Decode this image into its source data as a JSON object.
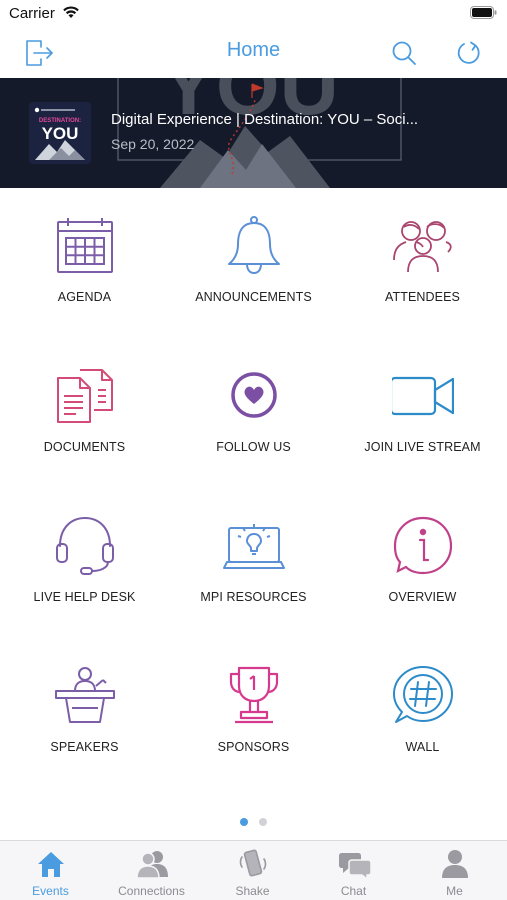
{
  "status": {
    "carrier": "Carrier"
  },
  "nav": {
    "title": "Home",
    "left_icon": "logout-icon",
    "search_icon": "search-icon",
    "refresh_icon": "refresh-icon"
  },
  "banner": {
    "title": "Digital Experience | Destination: YOU – Soci...",
    "date": "Sep 20, 2022",
    "thumb_text": "YOU",
    "thumb_subtext": "DESTINATION:"
  },
  "tiles": [
    {
      "label": "AGENDA",
      "icon": "calendar-icon",
      "color": "#7b5ea7"
    },
    {
      "label": "ANNOUNCEMENTS",
      "icon": "bell-icon",
      "color": "#5b8fd6"
    },
    {
      "label": "ATTENDEES",
      "icon": "people-icon",
      "color": "#a9456e"
    },
    {
      "label": "DOCUMENTS",
      "icon": "documents-icon",
      "color": "#d44b78"
    },
    {
      "label": "FOLLOW US",
      "icon": "heart-circle-icon",
      "color": "#7b4fa3"
    },
    {
      "label": "JOIN LIVE STREAM",
      "icon": "video-camera-icon",
      "color": "#2e8bc9"
    },
    {
      "label": "LIVE HELP DESK",
      "icon": "headset-icon",
      "color": "#7b5ea7"
    },
    {
      "label": "MPI RESOURCES",
      "icon": "laptop-idea-icon",
      "color": "#5b8fd6"
    },
    {
      "label": "OVERVIEW",
      "icon": "info-circle-icon",
      "color": "#c0418a"
    },
    {
      "label": "SPEAKERS",
      "icon": "podium-speaker-icon",
      "color": "#7b5ea7"
    },
    {
      "label": "SPONSORS",
      "icon": "trophy-icon",
      "color": "#d63a8e"
    },
    {
      "label": "WALL",
      "icon": "hashtag-chat-icon",
      "color": "#2e8bc9"
    }
  ],
  "pagination": {
    "pages": 2,
    "current": 1
  },
  "tabs": [
    {
      "label": "Events",
      "icon": "house-icon",
      "active": true
    },
    {
      "label": "Connections",
      "icon": "connections-icon",
      "active": false
    },
    {
      "label": "Shake",
      "icon": "phone-shake-icon",
      "active": false
    },
    {
      "label": "Chat",
      "icon": "chat-bubbles-icon",
      "active": false
    },
    {
      "label": "Me",
      "icon": "person-icon",
      "active": false
    }
  ],
  "colors": {
    "accent": "#4a9be0",
    "banner_bg": "#151a2a",
    "tab_inactive": "#8b8b92"
  }
}
